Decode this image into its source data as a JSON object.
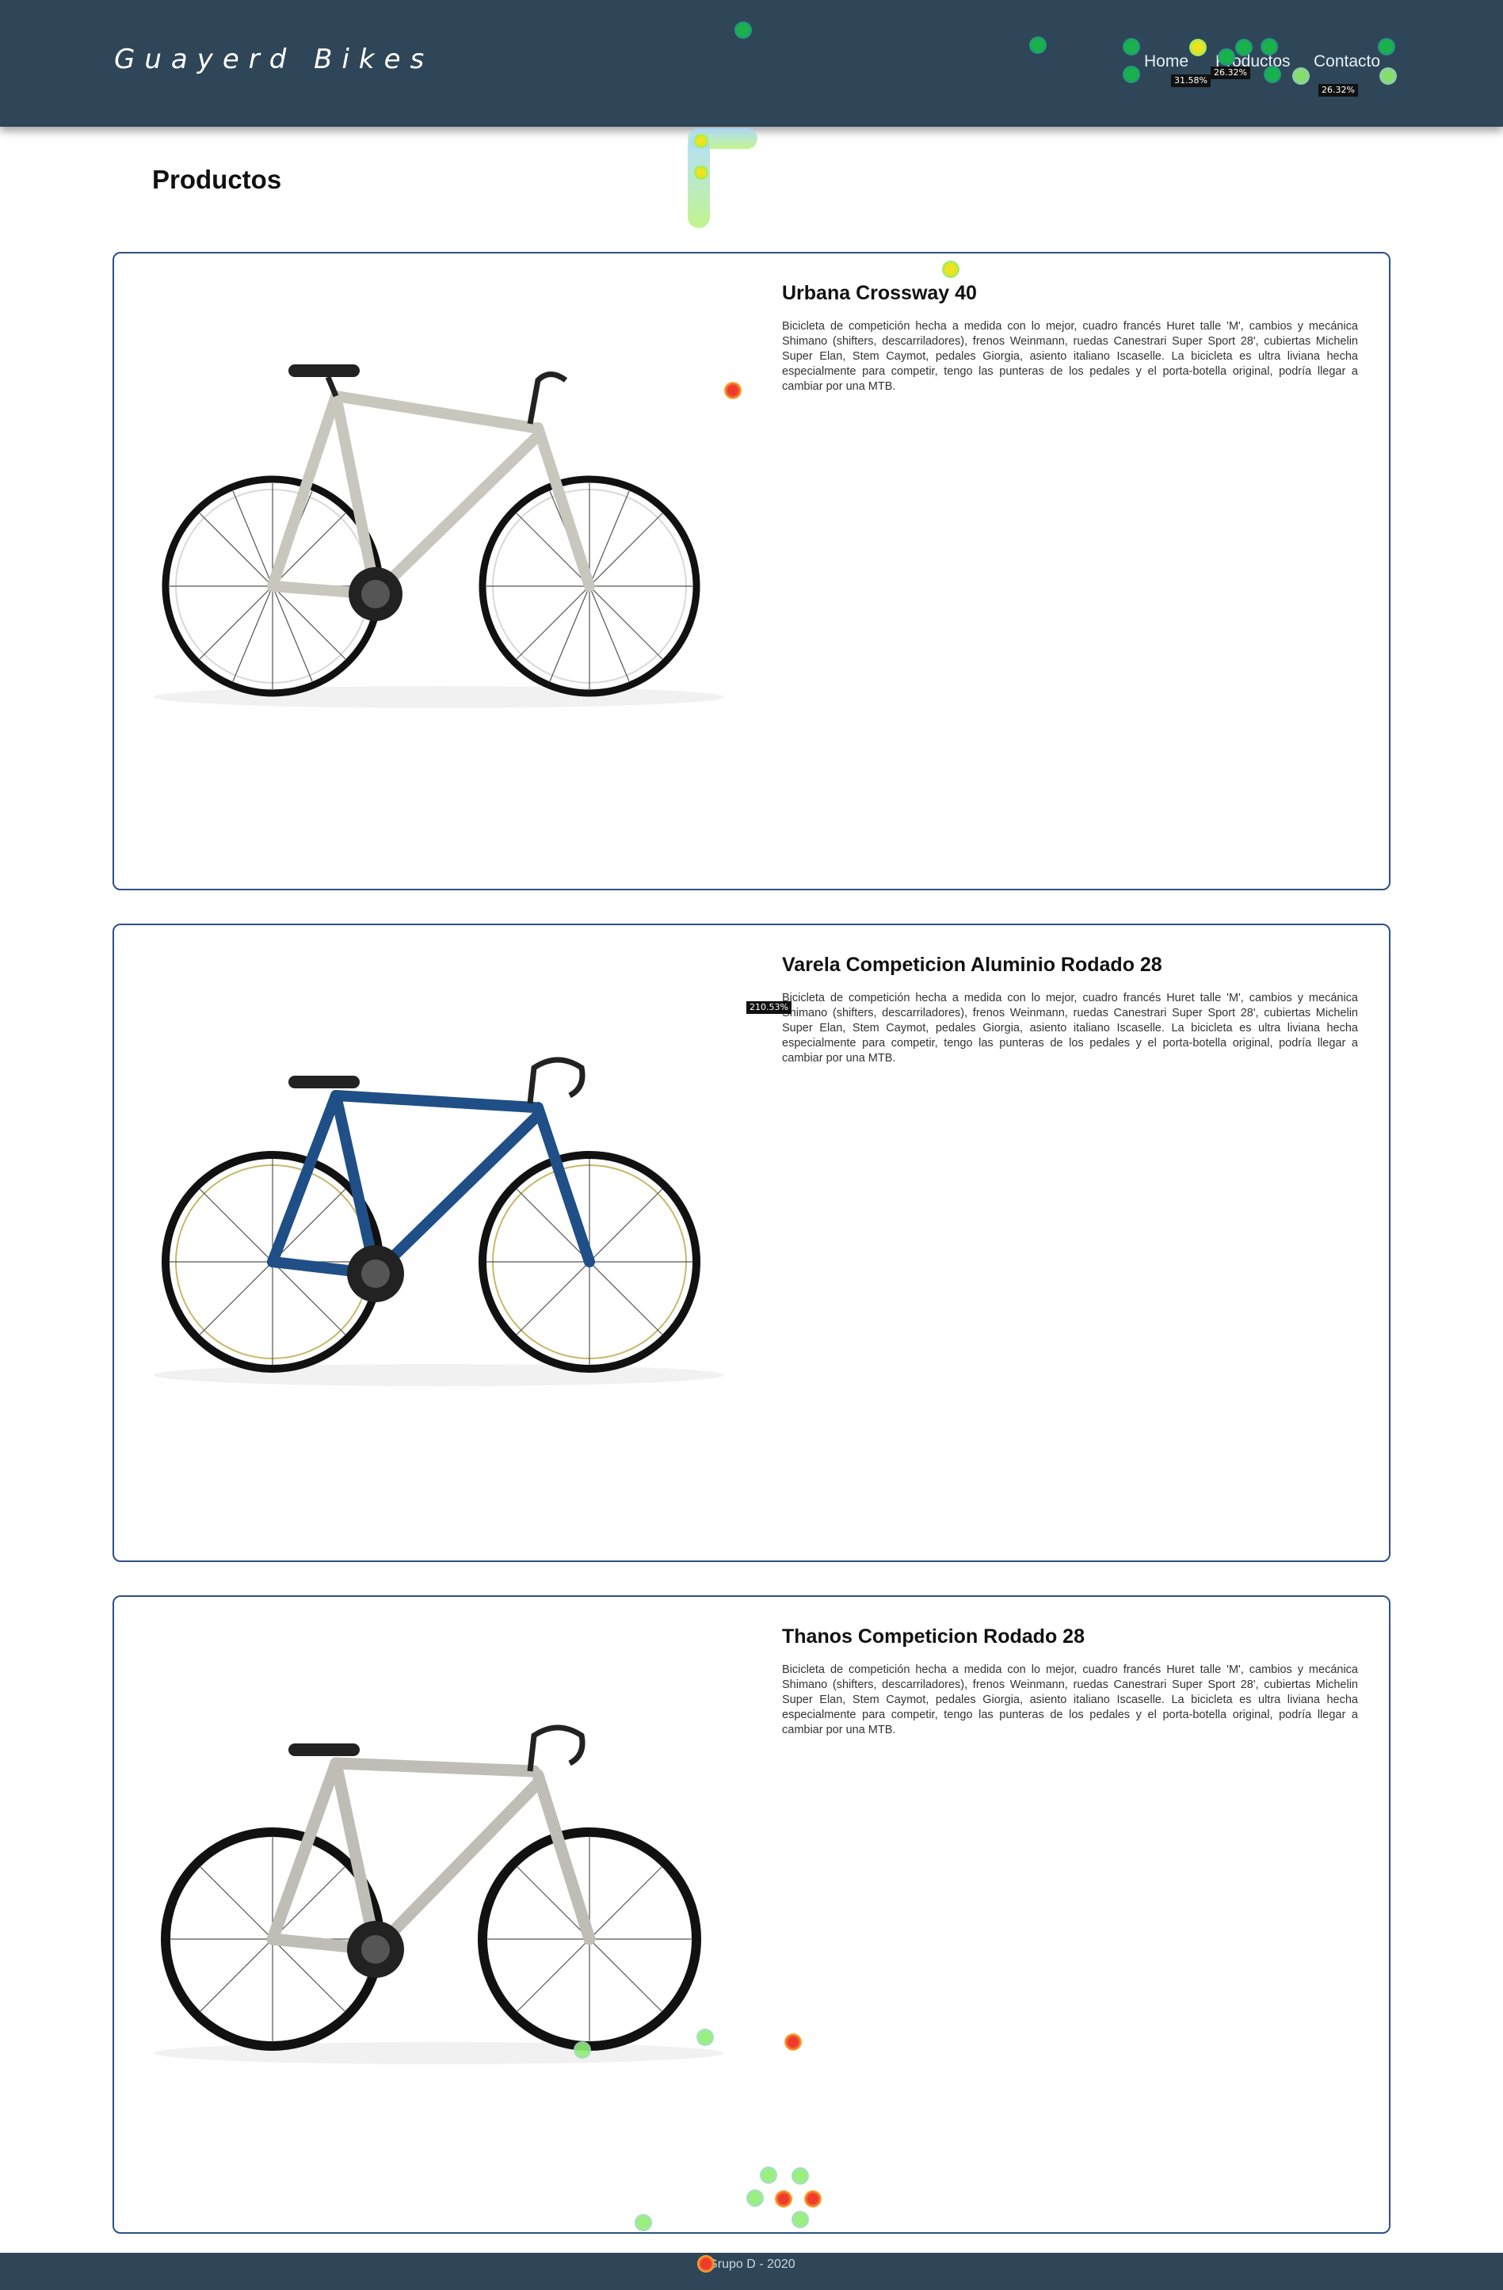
{
  "header": {
    "brand": "Guayerd Bikes",
    "nav": [
      {
        "label": "Home"
      },
      {
        "label": "Productos"
      },
      {
        "label": "Contacto"
      }
    ]
  },
  "page": {
    "title": "Productos"
  },
  "products": [
    {
      "name": "Urbana Crossway 40",
      "description": "Bicicleta de competición hecha a medida con lo mejor, cuadro francés Huret talle 'M', cambios y mecánica Shimano (shifters, descarriladores), frenos Weinmann, ruedas Canestrari Super Sport 28', cubiertas Michelin Super Elan, Stem Caymot, pedales Giorgia, asiento italiano Iscaselle. La bicicleta es ultra liviana hecha especialmente para competir, tengo las punteras de los pedales y el porta-botella original, podría llegar a cambiar por una MTB.",
      "frame_color": "#c9c6bd"
    },
    {
      "name": "Varela Competicion Aluminio Rodado 28",
      "description": "Bicicleta de competición hecha a medida con lo mejor, cuadro francés Huret talle 'M', cambios y mecánica Shimano (shifters, descarriladores), frenos Weinmann, ruedas Canestrari Super Sport 28', cubiertas Michelin Super Elan, Stem Caymot, pedales Giorgia, asiento italiano Iscaselle. La bicicleta es ultra liviana hecha especialmente para competir, tengo las punteras de los pedales y el porta-botella original, podría llegar a cambiar por una MTB.",
      "frame_color": "#1f4f86"
    },
    {
      "name": "Thanos Competicion Rodado 28",
      "description": "Bicicleta de competición hecha a medida con lo mejor, cuadro francés Huret talle 'M', cambios y mecánica Shimano (shifters, descarriladores), frenos Weinmann, ruedas Canestrari Super Sport 28', cubiertas Michelin Super Elan, Stem Caymot, pedales Giorgia, asiento italiano Iscaselle. La bicicleta es ultra liviana hecha especialmente para competir, tengo las punteras de los pedales y el porta-botella original, podría llegar a cambiar por una MTB.",
      "frame_color": "#bfbdb5"
    }
  ],
  "heatmap": {
    "labels": [
      "31.58%",
      "26.32%",
      "26.32%",
      "210.53%"
    ]
  },
  "footer": {
    "text": "Grupo D - 2020"
  },
  "colors": {
    "header_bg": "#2e4658",
    "card_border": "#2c5282",
    "footer_bg": "#2e4658"
  }
}
